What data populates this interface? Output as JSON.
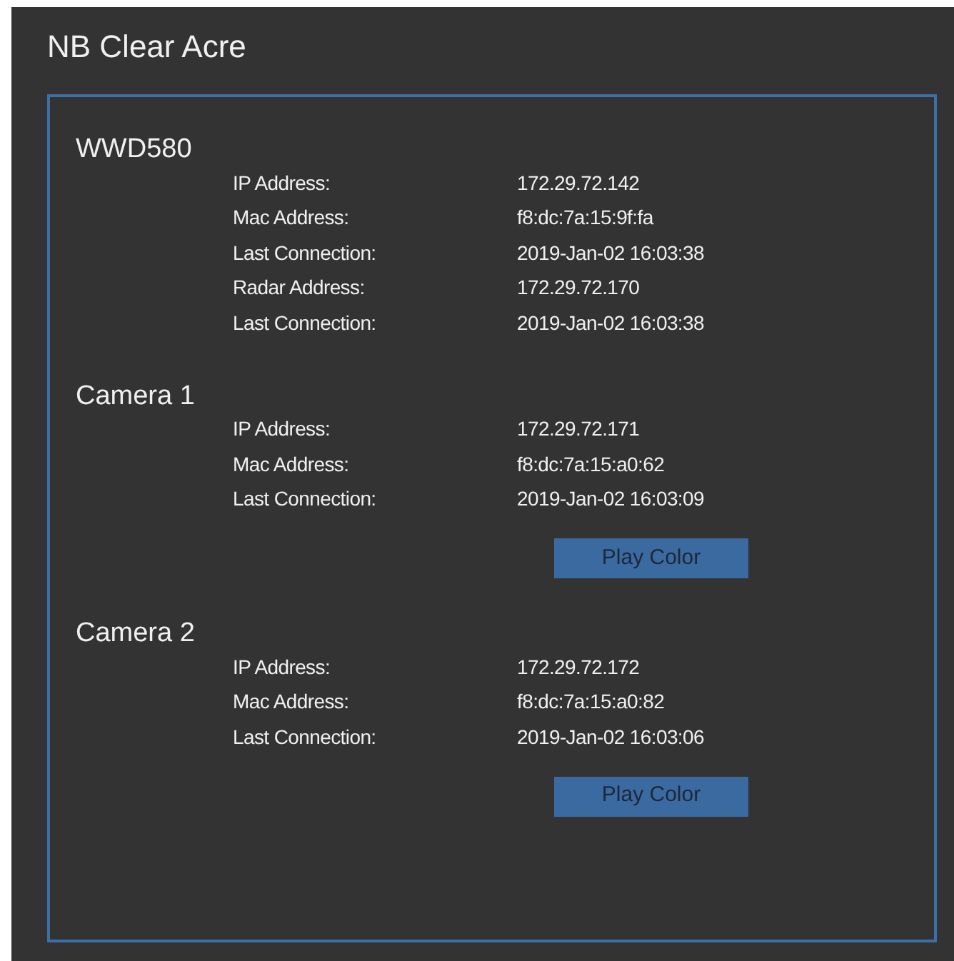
{
  "window": {
    "title": "NB Clear Acre"
  },
  "devices": [
    {
      "name": "WWD580",
      "fields": [
        {
          "label": "IP Address:",
          "value": "172.29.72.142"
        },
        {
          "label": "Mac Address:",
          "value": "f8:dc:7a:15:9f:fa"
        },
        {
          "label": "Last Connection:",
          "value": "2019-Jan-02 16:03:38"
        },
        {
          "label": "Radar Address:",
          "value": "172.29.72.170"
        },
        {
          "label": "Last Connection:",
          "value": "2019-Jan-02 16:03:38"
        }
      ]
    },
    {
      "name": "Camera 1",
      "fields": [
        {
          "label": "IP Address:",
          "value": "172.29.72.171"
        },
        {
          "label": "Mac Address:",
          "value": "f8:dc:7a:15:a0:62"
        },
        {
          "label": "Last Connection:",
          "value": "2019-Jan-02 16:03:09"
        }
      ],
      "button": "Play Color"
    },
    {
      "name": "Camera 2",
      "fields": [
        {
          "label": "IP Address:",
          "value": "172.29.72.172"
        },
        {
          "label": "Mac Address:",
          "value": "f8:dc:7a:15:a0:82"
        },
        {
          "label": "Last Connection:",
          "value": "2019-Jan-02 16:03:06"
        }
      ],
      "button": "Play Color"
    }
  ]
}
